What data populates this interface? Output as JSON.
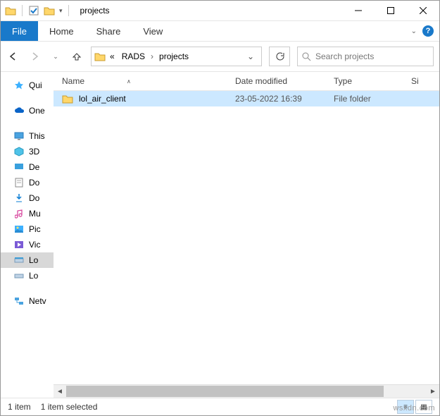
{
  "window": {
    "title": "projects"
  },
  "ribbon": {
    "file": "File",
    "tabs": [
      "Home",
      "Share",
      "View"
    ]
  },
  "breadcrumb": {
    "prefix": "«",
    "part1": "RADS",
    "part2": "projects"
  },
  "search": {
    "placeholder": "Search projects"
  },
  "columns": {
    "name": "Name",
    "date": "Date modified",
    "type": "Type",
    "size": "Si"
  },
  "rows": [
    {
      "name": "lol_air_client",
      "date": "23-05-2022 16:39",
      "type": "File folder"
    }
  ],
  "sidebar": {
    "quick": "Qui",
    "onedrive": "One",
    "thispc": "This",
    "items": [
      "3D",
      "De",
      "Do",
      "Do",
      "Mu",
      "Pic",
      "Vic",
      "Lo",
      "Lo"
    ],
    "network": "Netv"
  },
  "status": {
    "left": "1 item",
    "sel": "1 item selected"
  },
  "watermark": "wsxdn.com"
}
